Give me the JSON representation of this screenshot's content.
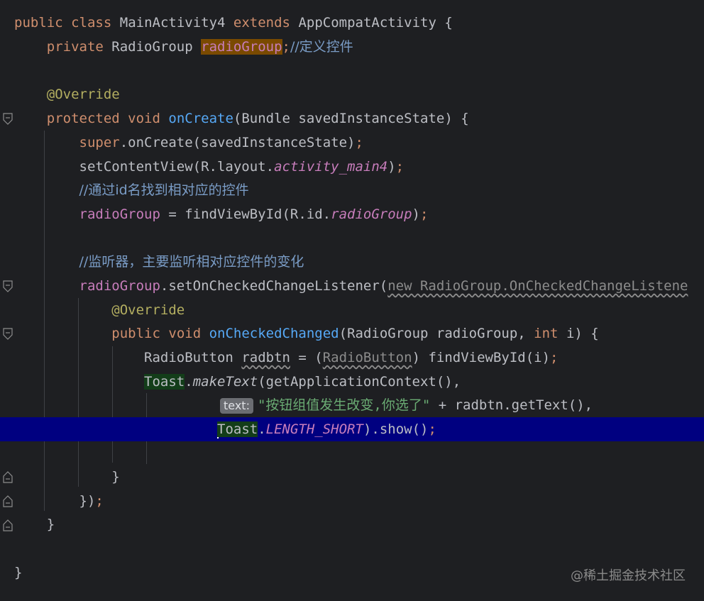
{
  "code": {
    "l1": {
      "kw_public": "public",
      "kw_class": "class",
      "name": "MainActivity4",
      "kw_extends": "extends",
      "parent": "AppCompatActivity",
      "brace": " {"
    },
    "l2": {
      "kw_private": "private",
      "type": "RadioGroup",
      "field": "radioGroup",
      "semi": ";",
      "comment": "//定义控件"
    },
    "l3": {
      "anno": "@Override"
    },
    "l4": {
      "kw_protected": "protected",
      "kw_void": "void",
      "method": "onCreate",
      "params": "(Bundle savedInstanceState) {"
    },
    "l5": {
      "kw_super": "super",
      "rest": ".onCreate(savedInstanceState)",
      "semi": ";"
    },
    "l6": {
      "call": "setContentView(R.layout.",
      "ref": "activity_main4",
      "close": ")",
      "semi": ";"
    },
    "l7": {
      "comment": "//通过id名找到相对应的控件"
    },
    "l8": {
      "field": "radioGroup",
      "mid": " = findViewById(R.id.",
      "ref": "radioGroup",
      "close": ")",
      "semi": ";"
    },
    "l9": {
      "comment": "//监听器，主要监听相对应控件的变化"
    },
    "l10": {
      "field": "radioGroup",
      "call": ".setOnCheckedChangeListener(",
      "new": "new RadioGroup.OnCheckedChangeListene"
    },
    "l11": {
      "anno": "@Override"
    },
    "l12": {
      "kw_public": "public",
      "kw_void": "void",
      "method": "onCheckedChanged",
      "params": "(RadioGroup radioGroup, ",
      "kw_int": "int",
      "rest": " i) {"
    },
    "l13": {
      "type": "RadioButton",
      "var": "radbtn",
      "mid": " = (",
      "cast": "RadioButton",
      "rest": ") findViewById(i)",
      "semi": ";"
    },
    "l14": {
      "cls": "Toast",
      "dot": ".",
      "method": "makeText",
      "rest": "(getApplicationContext(),"
    },
    "l15": {
      "hint": "text:",
      "str": "\"按钮组值发生改变,你选了\"",
      "rest": " + radbtn.getText(),"
    },
    "l16": {
      "cls": "Toast",
      "dot": ".",
      "const": "LENGTH_SHORT",
      "rest": ").show()",
      "semi": ";"
    },
    "l17": {
      "brace": "}"
    },
    "l18": {
      "brace": "})",
      "semi": ";"
    },
    "l19": {
      "brace": "}"
    },
    "l20": {
      "brace": "}"
    }
  },
  "watermark": "@稀土掘金技术社区",
  "colors": {
    "background": "#1e1f22",
    "keyword": "#cf8e6d",
    "function": "#56a8f5",
    "field": "#c77dbb",
    "annotation": "#b3ae60",
    "comment": "#7a9cc6",
    "string": "#6aab73",
    "current_line": "#000080"
  }
}
